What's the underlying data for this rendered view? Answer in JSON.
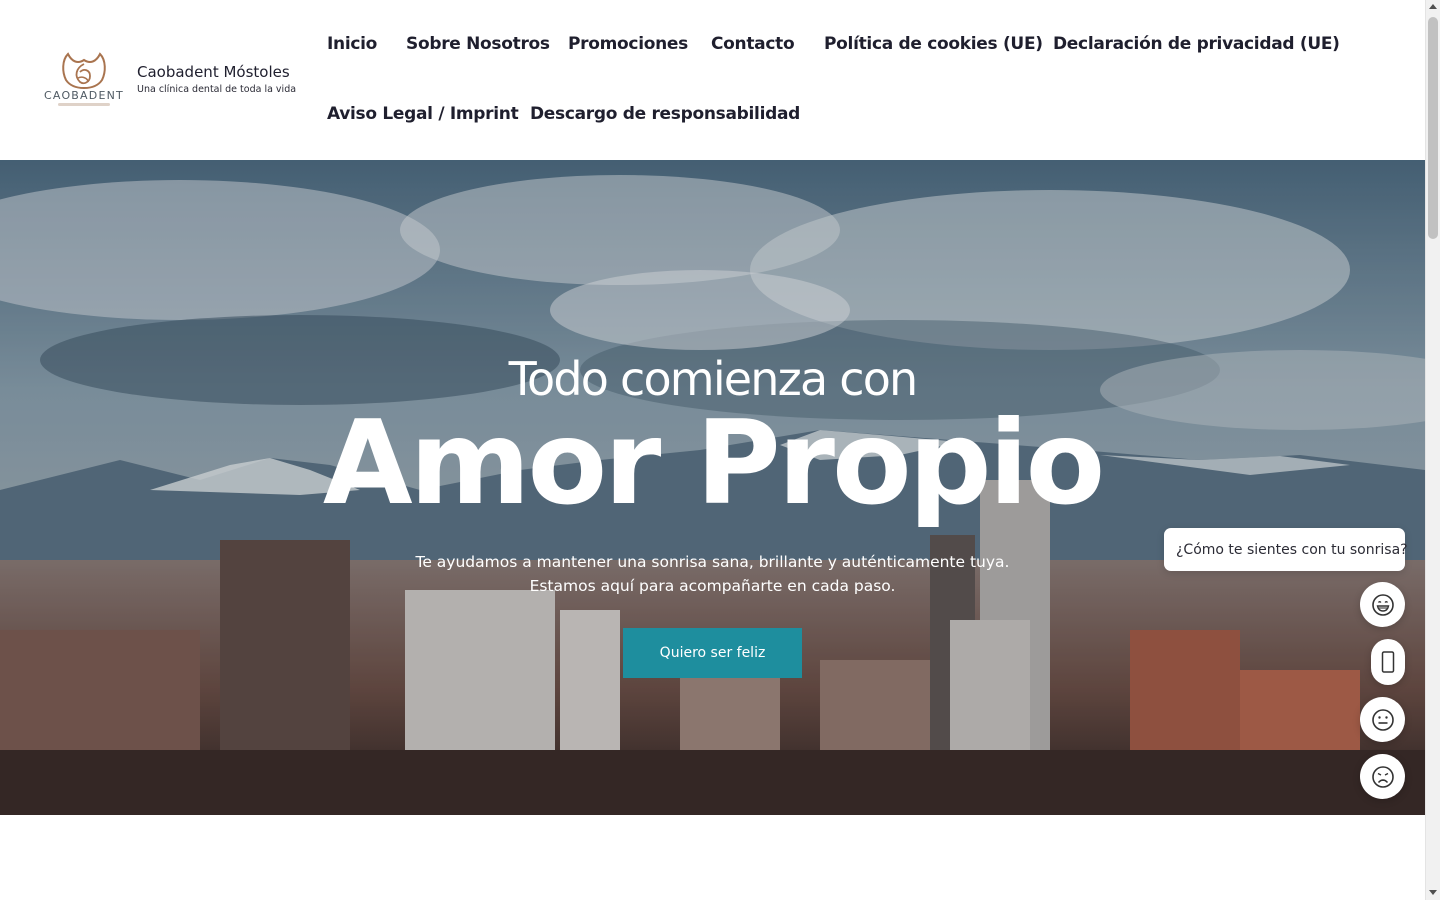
{
  "header": {
    "logo_word": "CAOBADENT",
    "site_title": "Caobadent Móstoles",
    "site_tagline": "Una clínica dental de toda la vida",
    "nav": [
      {
        "label": "Inicio"
      },
      {
        "label": "Sobre Nosotros"
      },
      {
        "label": "Promociones"
      },
      {
        "label": "Contacto"
      },
      {
        "label": "Política de cookies (UE)"
      },
      {
        "label": "Declaración de privacidad (UE)"
      },
      {
        "label": "Aviso Legal / Imprint"
      },
      {
        "label": "Descargo de responsabilidad"
      }
    ]
  },
  "hero": {
    "kicker": "Todo comienza con",
    "title": "Amor Propio",
    "text_line1": "Te ayudamos a mantener una sonrisa sana, brillante y auténticamente tuya.",
    "text_line2": "Estamos aquí para acompañarte en cada paso.",
    "cta_label": "Quiero ser feliz"
  },
  "feedback": {
    "question": "¿Cómo te sientes con tu sonrisa?",
    "options": [
      {
        "icon": "grin-face-icon"
      },
      {
        "icon": "phone-icon"
      },
      {
        "icon": "neutral-face-icon"
      },
      {
        "icon": "sad-face-icon"
      }
    ]
  },
  "colors": {
    "accent": "#1e8e9e",
    "logo": "#a9744f",
    "text": "#1f1f2e"
  }
}
